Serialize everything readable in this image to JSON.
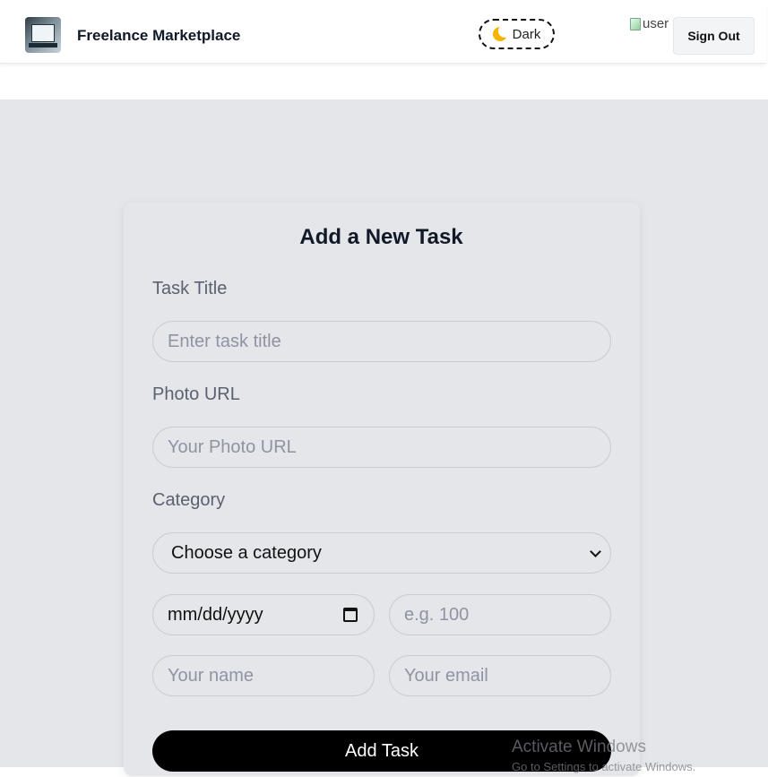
{
  "navbar": {
    "brand": "Freelance Marketplace",
    "theme_toggle_label": "Dark",
    "avatar_alt": "user",
    "signout_label": "Sign Out"
  },
  "form": {
    "title": "Add a New Task",
    "task_title_label": "Task Title",
    "task_title_placeholder": "Enter task title",
    "photo_label": "Photo URL",
    "photo_placeholder": "Your Photo URL",
    "category_label": "Category",
    "category_selected": "Choose a category",
    "date_placeholder": "mm/dd/yyyy",
    "budget_placeholder": "e.g. 100",
    "name_placeholder": "Your name",
    "email_placeholder": "Your email",
    "submit_label": "Add Task"
  },
  "watermark": {
    "line1": "Activate Windows",
    "line2": "Go to Settings to activate Windows."
  },
  "colors": {
    "page_bg": "#e5e6ea",
    "button_bg": "#000000",
    "toggle_border": "#111111"
  }
}
